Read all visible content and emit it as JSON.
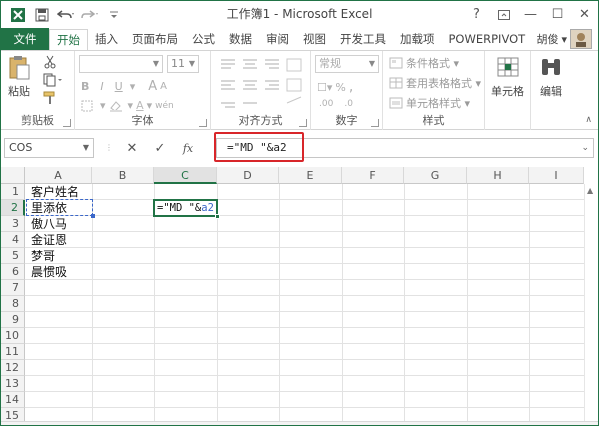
{
  "window": {
    "title": "工作簿1 - Microsoft Excel",
    "controls": {
      "help": "?",
      "ribbon_display": "▫",
      "minimize": "—",
      "maximize": "☐",
      "close": "✕"
    }
  },
  "quick_access": {
    "icons": [
      "excel-logo-icon",
      "save-icon",
      "undo-icon",
      "redo-icon",
      "customize-icon"
    ]
  },
  "tabs": [
    {
      "label": "文件",
      "kind": "file"
    },
    {
      "label": "开始",
      "kind": "active"
    },
    {
      "label": "插入"
    },
    {
      "label": "页面布局"
    },
    {
      "label": "公式"
    },
    {
      "label": "数据"
    },
    {
      "label": "审阅"
    },
    {
      "label": "视图"
    },
    {
      "label": "开发工具"
    },
    {
      "label": "加载项"
    },
    {
      "label": "POWERPIVOT"
    }
  ],
  "user": {
    "name": "胡俊",
    "menu": "▾"
  },
  "ribbon": {
    "clipboard": {
      "label": "剪贴板",
      "paste": "粘贴"
    },
    "font": {
      "label": "字体",
      "font_name": "",
      "font_size": "11",
      "a_big": "A",
      "a_small": "A",
      "bold": "B",
      "italic": "I",
      "underline": "U",
      "wen": "wén"
    },
    "alignment": {
      "label": "对齐方式"
    },
    "number": {
      "label": "数字",
      "format": "常规",
      "percent": "%",
      "comma": ",",
      "decimals_more": ".00",
      "decimals_less": ".0"
    },
    "styles": {
      "label": "样式",
      "conditional": "条件格式 ▾",
      "table": "套用表格格式 ▾",
      "cell_styles": "单元格样式 ▾"
    },
    "cells": {
      "label": "单元格"
    },
    "editing": {
      "label": "编辑"
    }
  },
  "formula_bar": {
    "name_box": "COS",
    "cancel": "✕",
    "enter": "✓",
    "fx": "fx",
    "formula": "=\"MD \"&a2"
  },
  "sheet": {
    "columns": [
      "A",
      "B",
      "C",
      "D",
      "E",
      "F",
      "G",
      "H",
      "I"
    ],
    "rows": [
      "1",
      "2",
      "3",
      "4",
      "5",
      "6",
      "7",
      "8",
      "9",
      "10",
      "11",
      "12",
      "13",
      "14",
      "15"
    ],
    "col_a": [
      "客户姓名",
      "里添依",
      "傲八马",
      "金证恩",
      "梦哥",
      "晨惯吸"
    ],
    "active_cell_prefix": "=\"MD \"&",
    "active_cell_ref": "a2"
  },
  "colors": {
    "accent": "#217346",
    "highlight_box": "#d8262a",
    "ref_blue": "#3b67c9"
  }
}
